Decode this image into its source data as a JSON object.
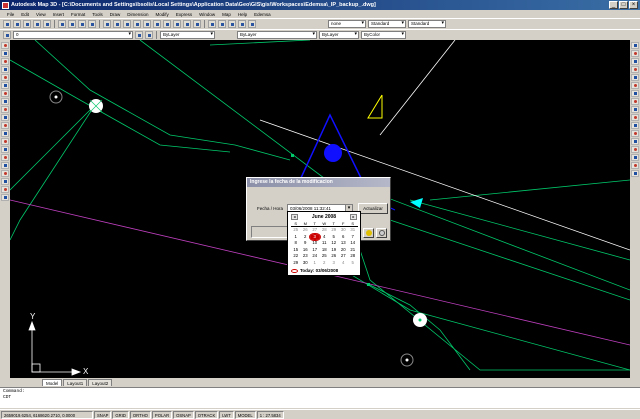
{
  "window": {
    "title": "Autodesk Map 3D - [C:\\Documents and Settings\\bsolis\\Local Settings\\Application Data\\Geo\\GIS\\gis\\Workspaces\\Edemsa\\_IP_backup_.dwg]",
    "buttons": {
      "minimize": "_",
      "maximize": "□",
      "close": "×"
    }
  },
  "menu": [
    "File",
    "Edit",
    "View",
    "Insert",
    "Format",
    "Tools",
    "Draw",
    "Dimension",
    "Modify",
    "Express",
    "Window",
    "Map",
    "Help",
    "Edemsa"
  ],
  "toolbar_combos": {
    "layer": "0",
    "color": "ByLayer",
    "linetype": "ByLayer",
    "lineweight": "ByLayer",
    "plotstyle": "ByColor",
    "textstyle": "Standard",
    "dimstyle": "Standard",
    "tablestyle": "none"
  },
  "tabs": [
    "Model",
    "Layout1",
    "Layout2"
  ],
  "command": {
    "line1": "Command:",
    "line2": "CDT"
  },
  "status": {
    "coords": "2659019.6254, 6168620.2710, 0.0000",
    "modes": [
      "SNAP",
      "GRID",
      "ORTHO",
      "POLAR",
      "OSNAP",
      "OTRACK",
      "LWT",
      "MODEL"
    ],
    "scale": "1 : 27.5834"
  },
  "dialog": {
    "title": "Ingrese la fecha de la modificacion",
    "label": "Fecha / Hora",
    "value": "03/06/2008 11:32:41",
    "update_button": "Actualizar"
  },
  "calendar": {
    "month": "June 2008",
    "prev": "◂",
    "next": "▸",
    "weekdays": [
      "S",
      "M",
      "T",
      "W",
      "T",
      "F",
      "S"
    ],
    "days": [
      [
        "25",
        "26",
        "27",
        "28",
        "29",
        "30",
        "31"
      ],
      [
        "1",
        "2",
        "3",
        "4",
        "5",
        "6",
        "7"
      ],
      [
        "8",
        "9",
        "10",
        "11",
        "12",
        "13",
        "14"
      ],
      [
        "15",
        "16",
        "17",
        "18",
        "19",
        "20",
        "21"
      ],
      [
        "22",
        "23",
        "24",
        "25",
        "26",
        "27",
        "28"
      ],
      [
        "29",
        "30",
        "1",
        "2",
        "3",
        "4",
        "5"
      ]
    ],
    "today_label": "Today: 03/06/2008"
  },
  "ucs": {
    "x": "X",
    "y": "Y"
  },
  "colors": {
    "green": "#00c96b",
    "magenta": "#c040c0",
    "blue": "#1010ff",
    "white": "#ffffff",
    "yellow": "#ffff00",
    "cyan": "#00ffff"
  }
}
